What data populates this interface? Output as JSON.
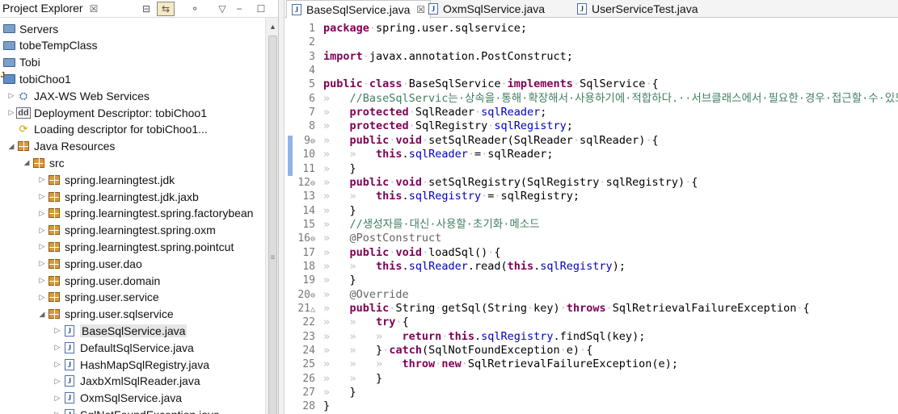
{
  "explorer": {
    "title": "Project Explorer",
    "close": "☒",
    "tree": [
      {
        "indent": 0,
        "twisty": "",
        "icon": "folder",
        "label": "Servers"
      },
      {
        "indent": 0,
        "twisty": "",
        "icon": "folder",
        "label": "tobeTempClass"
      },
      {
        "indent": 0,
        "twisty": "",
        "icon": "folder",
        "label": "Tobi"
      },
      {
        "indent": 0,
        "twisty": "",
        "icon": "proj",
        "label": "tobiChoo1"
      },
      {
        "indent": 1,
        "twisty": "▷",
        "icon": "ws",
        "label": "JAX-WS Web Services"
      },
      {
        "indent": 1,
        "twisty": "▷",
        "icon": "dd",
        "label": "Deployment Descriptor: tobiChoo1"
      },
      {
        "indent": 1,
        "twisty": "",
        "icon": "load",
        "label": "Loading descriptor for tobiChoo1..."
      },
      {
        "indent": 1,
        "twisty": "◢",
        "icon": "jres",
        "label": "Java Resources"
      },
      {
        "indent": 2,
        "twisty": "◢",
        "icon": "src",
        "label": "src"
      },
      {
        "indent": 3,
        "twisty": "▷",
        "icon": "pkg",
        "label": "spring.learningtest.jdk"
      },
      {
        "indent": 3,
        "twisty": "▷",
        "icon": "pkg",
        "label": "spring.learningtest.jdk.jaxb"
      },
      {
        "indent": 3,
        "twisty": "▷",
        "icon": "pkg",
        "label": "spring.learningtest.spring.factorybean"
      },
      {
        "indent": 3,
        "twisty": "▷",
        "icon": "pkg",
        "label": "spring.learningtest.spring.oxm"
      },
      {
        "indent": 3,
        "twisty": "▷",
        "icon": "pkg",
        "label": "spring.learningtest.spring.pointcut"
      },
      {
        "indent": 3,
        "twisty": "▷",
        "icon": "pkg",
        "label": "spring.user.dao"
      },
      {
        "indent": 3,
        "twisty": "▷",
        "icon": "pkg",
        "label": "spring.user.domain"
      },
      {
        "indent": 3,
        "twisty": "▷",
        "icon": "pkg",
        "label": "spring.user.service"
      },
      {
        "indent": 3,
        "twisty": "◢",
        "icon": "pkg",
        "label": "spring.user.sqlservice"
      },
      {
        "indent": 4,
        "twisty": "▷",
        "icon": "java",
        "label": "BaseSqlService.java",
        "selected": true
      },
      {
        "indent": 4,
        "twisty": "▷",
        "icon": "java",
        "label": "DefaultSqlService.java"
      },
      {
        "indent": 4,
        "twisty": "▷",
        "icon": "java",
        "label": "HashMapSqlRegistry.java"
      },
      {
        "indent": 4,
        "twisty": "▷",
        "icon": "java",
        "label": "JaxbXmlSqlReader.java"
      },
      {
        "indent": 4,
        "twisty": "▷",
        "icon": "java",
        "label": "OxmSqlService.java"
      },
      {
        "indent": 4,
        "twisty": "▷",
        "icon": "java",
        "label": "SqlNotFoundException.java"
      }
    ]
  },
  "tabs": [
    {
      "label": "BaseSqlService.java",
      "active": true,
      "close": "☒"
    },
    {
      "label": "OxmSqlService.java",
      "active": false,
      "close": ""
    },
    {
      "label": "UserServiceTest.java",
      "active": false,
      "close": ""
    }
  ],
  "lines": [
    {
      "n": "1",
      "mark": "",
      "html": "<span class='kw'>package</span><span class='ws'>·</span>spring.user.sqlservice;"
    },
    {
      "n": "2",
      "mark": "",
      "html": ""
    },
    {
      "n": "3",
      "mark": "",
      "html": "<span class='kw'>import</span><span class='ws'>·</span>javax.annotation.PostConstruct;"
    },
    {
      "n": "4",
      "mark": "",
      "html": ""
    },
    {
      "n": "5",
      "mark": "",
      "html": "<span class='kw'>public</span><span class='ws'>·</span><span class='kw'>class</span><span class='ws'>·</span>BaseSqlService<span class='ws'>·</span><span class='kw'>implements</span><span class='ws'>·</span>SqlService<span class='ws'>·</span>{"
    },
    {
      "n": "6",
      "mark": "",
      "html": "<span class='ws'>»   </span><span class='cm'>//BaseSqlServic는·상속을·통해·확장해서·사용하기에·적합하다.··서브클래스에서·필요한·경우·접근할·수·있도록·protected·선언</span>"
    },
    {
      "n": "7",
      "mark": "",
      "html": "<span class='ws'>»   </span><span class='kw'>protected</span><span class='ws'>·</span>SqlReader<span class='ws'>·</span><span class='fld'>sqlReader</span>;"
    },
    {
      "n": "8",
      "mark": "",
      "html": "<span class='ws'>»   </span><span class='kw'>protected</span><span class='ws'>·</span>SqlRegistry<span class='ws'>·</span><span class='fld'>sqlRegistry</span>;"
    },
    {
      "n": "9",
      "mark": "⊖",
      "html": "<span class='ws'>»   </span><span class='kw'>public</span><span class='ws'>·</span><span class='kw'>void</span><span class='ws'>·</span>setSqlReader(SqlReader<span class='ws'>·</span>sqlReader)<span class='ws'>·</span>{"
    },
    {
      "n": "10",
      "mark": "",
      "html": "<span class='ws'>»   »   </span><span class='kw'>this</span>.<span class='fld'>sqlReader</span><span class='ws'>·</span>=<span class='ws'>·</span>sqlReader;"
    },
    {
      "n": "11",
      "mark": "",
      "html": "<span class='ws'>»   </span>}"
    },
    {
      "n": "12",
      "mark": "⊖",
      "html": "<span class='ws'>»   </span><span class='kw'>public</span><span class='ws'>·</span><span class='kw'>void</span><span class='ws'>·</span>setSqlRegistry(SqlRegistry<span class='ws'>·</span>sqlRegistry)<span class='ws'>·</span>{"
    },
    {
      "n": "13",
      "mark": "",
      "html": "<span class='ws'>»   »   </span><span class='kw'>this</span>.<span class='fld'>sqlRegistry</span><span class='ws'>·</span>=<span class='ws'>·</span>sqlRegistry;"
    },
    {
      "n": "14",
      "mark": "",
      "html": "<span class='ws'>»   </span>}"
    },
    {
      "n": "15",
      "mark": "",
      "html": "<span class='ws'>»   </span><span class='cm'>//생성자를·대신·사용할·초기화·메소드</span>"
    },
    {
      "n": "16",
      "mark": "⊖",
      "html": "<span class='ws'>»   </span><span class='ann'>@PostConstruct</span>"
    },
    {
      "n": "17",
      "mark": "",
      "html": "<span class='ws'>»   </span><span class='kw'>public</span><span class='ws'>·</span><span class='kw'>void</span><span class='ws'>·</span>loadSql()<span class='ws'>·</span>{"
    },
    {
      "n": "18",
      "mark": "",
      "html": "<span class='ws'>»   »   </span><span class='kw'>this</span>.<span class='fld'>sqlReader</span>.read(<span class='kw'>this</span>.<span class='fld'>sqlRegistry</span>);"
    },
    {
      "n": "19",
      "mark": "",
      "html": "<span class='ws'>»   </span>}"
    },
    {
      "n": "20",
      "mark": "⊖",
      "html": "<span class='ws'>»   </span><span class='ann'>@Override</span>"
    },
    {
      "n": "21",
      "mark": "△",
      "html": "<span class='ws'>»   </span><span class='kw'>public</span><span class='ws'>·</span>String<span class='ws'>·</span>getSql(String<span class='ws'>·</span>key)<span class='ws'>·</span><span class='kw'>throws</span><span class='ws'>·</span>SqlRetrievalFailureException<span class='ws'>·</span>{"
    },
    {
      "n": "22",
      "mark": "",
      "html": "<span class='ws'>»   »   </span><span class='kw'>try</span><span class='ws'>·</span>{"
    },
    {
      "n": "23",
      "mark": "",
      "html": "<span class='ws'>»   »   »   </span><span class='kw'>return</span><span class='ws'>·</span><span class='kw'>this</span>.<span class='fld'>sqlRegistry</span>.findSql(key);"
    },
    {
      "n": "24",
      "mark": "",
      "html": "<span class='ws'>»   »   </span>}<span class='ws'>·</span><span class='kw'>catch</span>(SqlNotFoundException<span class='ws'>·</span>e)<span class='ws'>·</span>{"
    },
    {
      "n": "25",
      "mark": "",
      "html": "<span class='ws'>»   »   »   </span><span class='kw'>throw</span><span class='ws'>·</span><span class='kw'>new</span><span class='ws'>·</span>SqlRetrievalFailureException(e);"
    },
    {
      "n": "26",
      "mark": "",
      "html": "<span class='ws'>»   »   </span>}"
    },
    {
      "n": "27",
      "mark": "",
      "html": "<span class='ws'>»   </span>}"
    },
    {
      "n": "28",
      "mark": "",
      "html": "}"
    }
  ]
}
